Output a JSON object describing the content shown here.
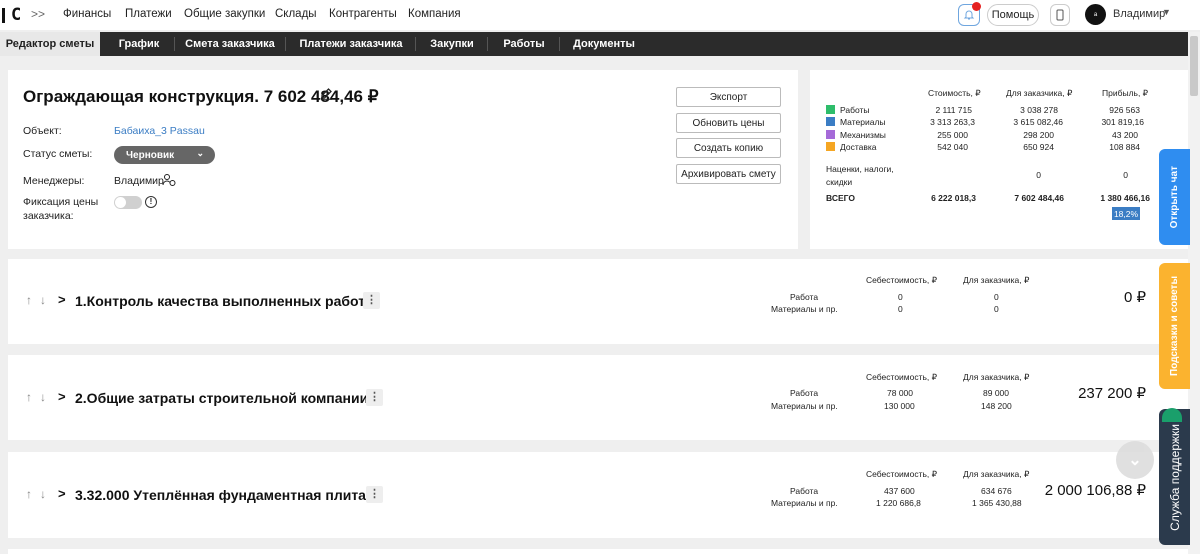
{
  "app": {
    "logo_text": "C",
    "nav": [
      "Финансы",
      "Платежи",
      "Общие закупки",
      "Склады",
      "Контрагенты",
      "Компания"
    ],
    "help_label": "Помощь",
    "user_name": "Владимир",
    "avatar_text": "a"
  },
  "tabs": [
    "Редактор сметы",
    "График",
    "Смета заказчика",
    "Платежи заказчика",
    "Закупки",
    "Работы",
    "Документы"
  ],
  "estimate": {
    "title": "Ограждающая конструкция. 7 602 484,46 ₽",
    "object_label": "Объект:",
    "object_value": "Бабаиха_3 Passau",
    "status_label": "Статус сметы:",
    "status_value": "Черновик",
    "managers_label": "Менеджеры:",
    "managers_value": "Владимир",
    "fix_label_1": "Фиксация цены",
    "fix_label_2": "заказчика:",
    "buttons": [
      "Экспорт",
      "Обновить цены",
      "Создать копию",
      "Архивировать смету"
    ]
  },
  "summary": {
    "headers": [
      "Стоимость, ₽",
      "Для заказчика, ₽",
      "Прибыль, ₽"
    ],
    "rows": [
      {
        "name": "Работы",
        "color": "#2ebd6b",
        "cost": "2 111 715",
        "client": "3 038 278",
        "profit": "926 563"
      },
      {
        "name": "Материалы",
        "color": "#3b7dc4",
        "cost": "3 313 263,3",
        "client": "3 615 082,46",
        "profit": "301 819,16"
      },
      {
        "name": "Механизмы",
        "color": "#a56ad8",
        "cost": "255 000",
        "client": "298 200",
        "profit": "43 200"
      },
      {
        "name": "Доставка",
        "color": "#f5a623",
        "cost": "542 040",
        "client": "650 924",
        "profit": "108 884"
      }
    ],
    "markup_label_1": "Наценки, налоги,",
    "markup_label_2": "скидки",
    "markup_client": "0",
    "markup_profit": "0",
    "total_label": "ВСЕГО",
    "total_cost": "6 222 018,3",
    "total_client": "7 602 484,46",
    "total_profit": "1 380 466,16",
    "total_pct": "18,2%"
  },
  "sections": [
    {
      "title": "1.Контроль качества выполненных работ",
      "h_cost": "Себестоимость, ₽",
      "h_client": "Для заказчика, ₽",
      "row1": "Работа",
      "row2": "Материалы и пр.",
      "cost1": "0",
      "cost2": "0",
      "client1": "0",
      "client2": "0",
      "total": "0 ₽"
    },
    {
      "title": "2.Общие затраты строительной компании",
      "h_cost": "Себестоимость, ₽",
      "h_client": "Для заказчика, ₽",
      "row1": "Работа",
      "row2": "Материалы и пр.",
      "cost1": "78 000",
      "cost2": "130 000",
      "client1": "89 000",
      "client2": "148 200",
      "total": "237 200 ₽"
    },
    {
      "title": "3.32.000 Утеплённая фундаментная плита",
      "h_cost": "Себестоимость, ₽",
      "h_client": "Для заказчика, ₽",
      "row1": "Работа",
      "row2": "Материалы и пр.",
      "cost1": "437 600",
      "cost2": "1 220 686,8",
      "client1": "634 676",
      "client2": "1 365 430,88",
      "total": "2 000 106,88 ₽"
    }
  ],
  "side": {
    "chat": "Открыть чат",
    "tips": "Подсказки и советы",
    "support": "Служба поддержки"
  }
}
